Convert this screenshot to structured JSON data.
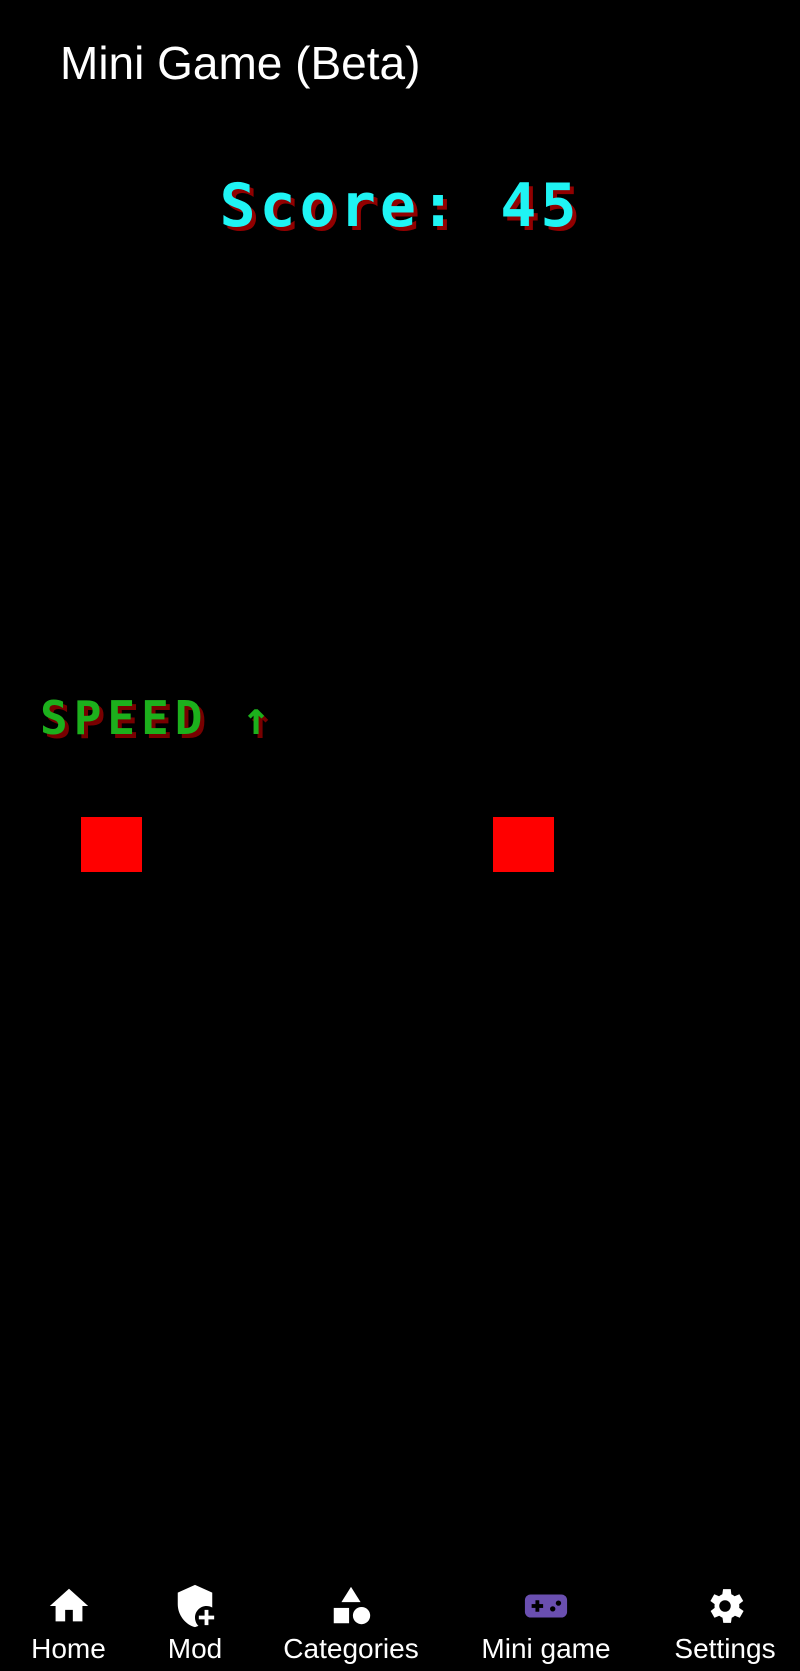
{
  "header": {
    "title": "Mini Game (Beta)"
  },
  "game": {
    "score_text": "Score: 45",
    "speed_text": "SPEED ↑",
    "block_color": "#ff0000"
  },
  "colors": {
    "score": "#1ff4f4",
    "speed": "#1cb01c",
    "nav_active": "#6a4fb0",
    "nav_inactive": "#ffffff",
    "background": "#000000"
  },
  "bottom_nav": {
    "items": [
      {
        "label": "Home",
        "icon": "home-icon",
        "active": false
      },
      {
        "label": "Mod",
        "icon": "shield-plus-icon",
        "active": false
      },
      {
        "label": "Categories",
        "icon": "shapes-icon",
        "active": false
      },
      {
        "label": "Mini game",
        "icon": "gamepad-icon",
        "active": true
      },
      {
        "label": "Settings",
        "icon": "gear-icon",
        "active": false
      }
    ]
  }
}
